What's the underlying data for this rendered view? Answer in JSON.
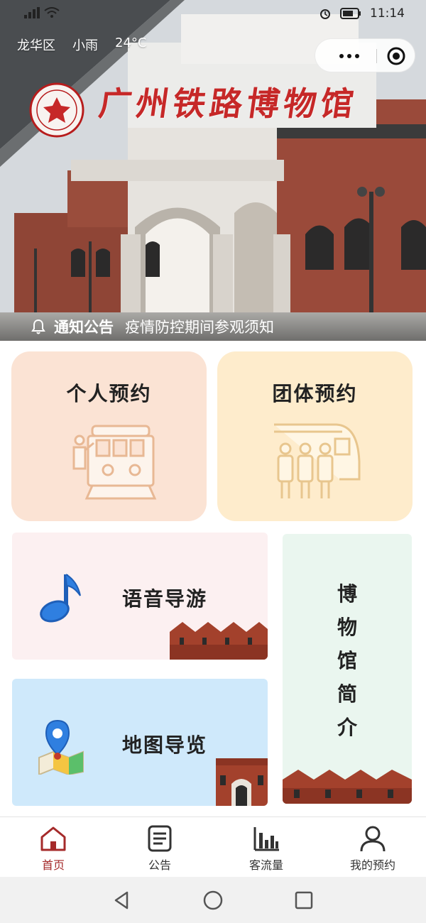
{
  "status_bar": {
    "left_icons": [
      "signal-icon",
      "wifi-icon"
    ],
    "right_icons": [
      "alarm-icon",
      "battery-icon"
    ],
    "time": "11:14"
  },
  "weather": {
    "district": "龙华区",
    "condition": "小雨",
    "temperature": "24°C"
  },
  "capsule": {
    "more_icon": "more-dots-icon",
    "close_icon": "target-circle-icon"
  },
  "hero": {
    "museum_name": "广州铁路博物馆",
    "logo_icon": "museum-seal-logo-icon"
  },
  "notice": {
    "icon": "bell-icon",
    "label": "通知公告",
    "text": "疫情防控期间参观须知"
  },
  "cards": {
    "personal": {
      "label": "个人预约",
      "icon": "tram-conductor-icon"
    },
    "group": {
      "label": "团体预约",
      "icon": "train-passengers-icon"
    },
    "audio": {
      "label": "语音导游",
      "icon": "music-note-icon"
    },
    "map": {
      "label": "地图导览",
      "icon": "map-pin-icon"
    },
    "intro": {
      "chars": [
        "博",
        "物",
        "馆",
        "简",
        "介"
      ]
    }
  },
  "tabbar": {
    "items": [
      {
        "label": "首页",
        "icon": "home-icon",
        "active": true
      },
      {
        "label": "公告",
        "icon": "document-list-icon",
        "active": false
      },
      {
        "label": "客流量",
        "icon": "bar-chart-icon",
        "active": false
      },
      {
        "label": "我的预约",
        "icon": "user-icon",
        "active": false
      }
    ],
    "active_color": "#a52a2a"
  },
  "system_nav": {
    "icons": [
      "back-triangle-icon",
      "home-circle-icon",
      "recents-square-icon"
    ]
  },
  "colors": {
    "personal_bg": "#fbe3d4",
    "group_bg": "#feeccc",
    "audio_bg": "#fcf0f1",
    "map_bg": "#cfe9fb",
    "intro_bg": "#eaf6ef",
    "brand_red": "#c62828"
  }
}
